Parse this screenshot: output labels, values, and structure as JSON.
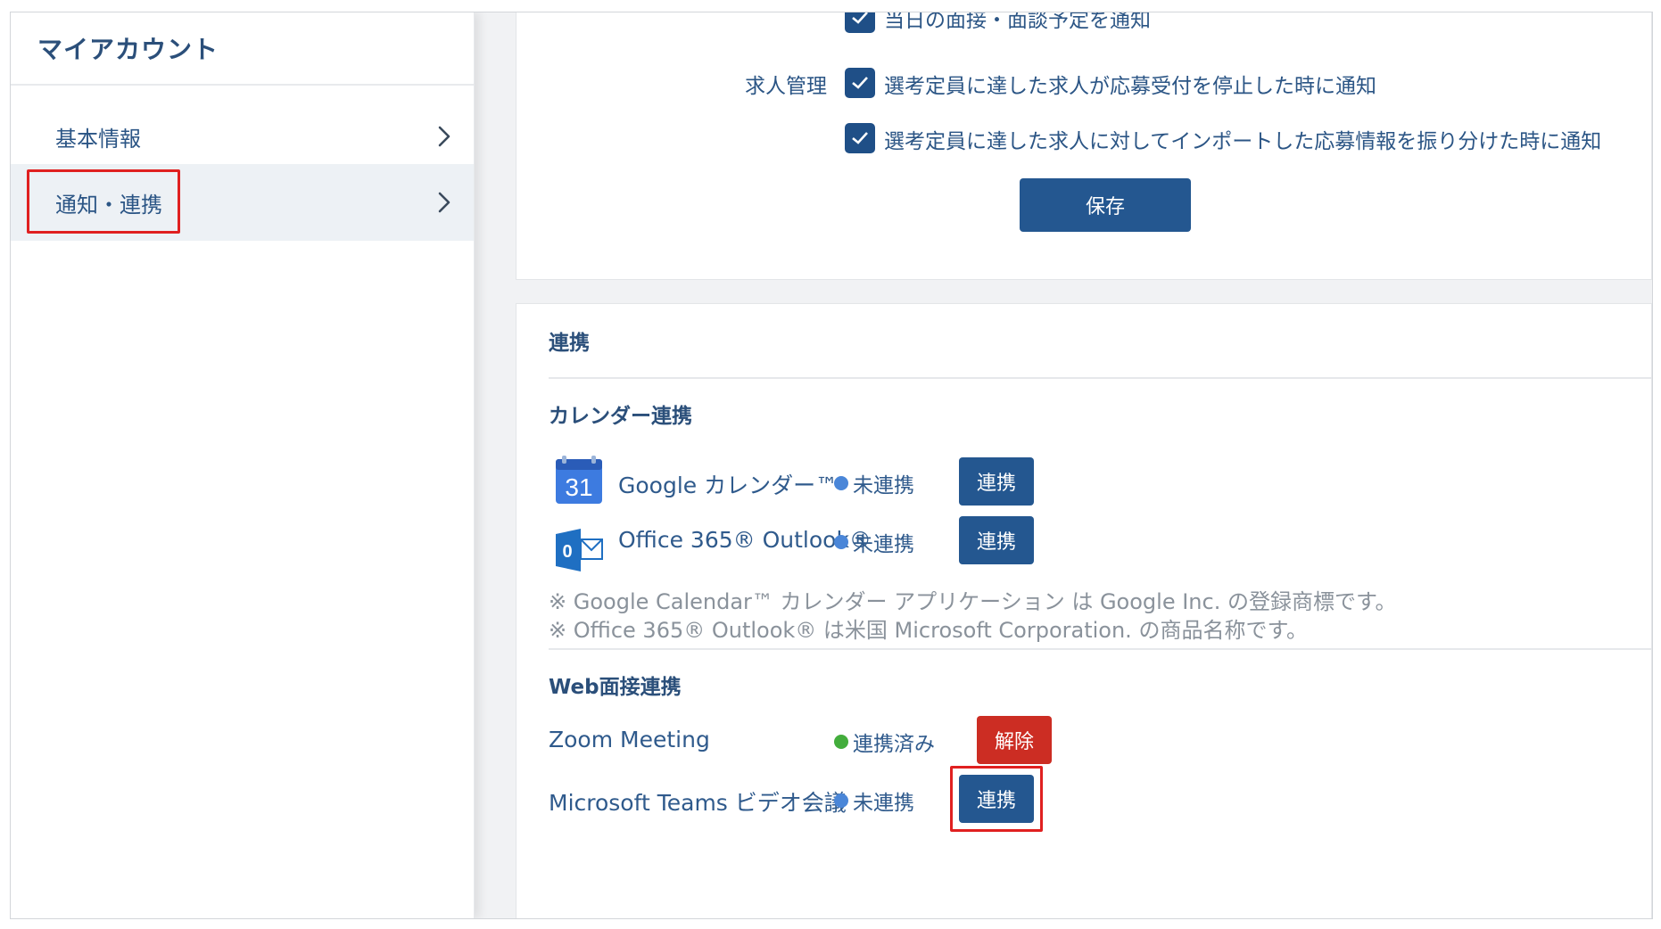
{
  "sidebar": {
    "title": "マイアカウント",
    "items": [
      {
        "label": "基本情報"
      },
      {
        "label": "通知・連携"
      }
    ]
  },
  "notifications": {
    "top_partial": "当日の面接・面談予定を通知",
    "job_section_label": "求人管理",
    "job_options": [
      "選考定員に達した求人が応募受付を停止した時に通知",
      "選考定員に達した求人に対してインポートした応募情報を振り分けた時に通知"
    ],
    "save_label": "保存"
  },
  "integrations": {
    "title": "連携",
    "calendar": {
      "heading": "カレンダー連携",
      "services": [
        {
          "name": "Google カレンダー™",
          "status": "未連携",
          "action": "連携",
          "icon_text": "31"
        },
        {
          "name": "Office 365® Outlook®",
          "status": "未連携",
          "action": "連携",
          "icon_text": "0"
        }
      ],
      "notes": [
        "※ Google Calendar™ カレンダー アプリケーション は Google Inc. の登録商標です。",
        "※ Office 365® Outlook® は米国 Microsoft Corporation. の商品名称です。"
      ]
    },
    "web": {
      "heading": "Web面接連携",
      "services": [
        {
          "name": "Zoom Meeting",
          "status": "連携済み",
          "action": "解除"
        },
        {
          "name": "Microsoft Teams ビデオ会議",
          "status": "未連携",
          "action": "連携"
        }
      ]
    }
  },
  "colors": {
    "primary": "#245790",
    "danger": "#cc2d23",
    "highlight": "#e02020",
    "status_unlinked": "#4a86d8",
    "status_linked": "#43ad3c"
  }
}
